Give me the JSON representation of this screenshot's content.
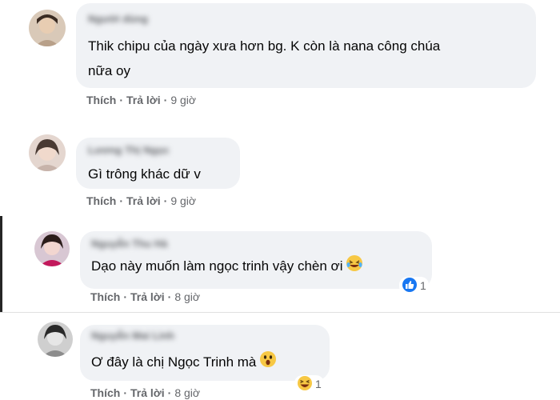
{
  "comments": [
    {
      "author": "Người dùng",
      "text_line1": "Thik chipu của ngày xưa hơn bg. K còn là nana công chúa",
      "text_line2": "nữa oy",
      "like_label": "Thích",
      "reply_label": "Trả lời",
      "separator": "·",
      "time": "9 giờ"
    },
    {
      "author": "Lương Thị Ngọc",
      "text_line1": "Gì trông khác dữ v",
      "like_label": "Thích",
      "reply_label": "Trả lời",
      "separator": "·",
      "time": "9 giờ"
    },
    {
      "author": "Nguyễn Thu Hà",
      "text_line1": "Dạo này muốn làm ngọc trinh vậy chèn ơi",
      "emoji": "laughing-face-icon",
      "reaction_icon": "like-reaction-icon",
      "reaction_count": "1",
      "like_label": "Thích",
      "reply_label": "Trả lời",
      "separator": "·",
      "time": "8 giờ"
    },
    {
      "author": "Nguyễn Mai Linh",
      "text_line1": "Ơ đây là chị Ngọc Trinh mà",
      "emoji": "surprised-face-icon",
      "reaction_icon": "haha-reaction-icon",
      "reaction_count": "1",
      "like_label": "Thích",
      "reply_label": "Trả lời",
      "separator": "·",
      "time": "8 giờ"
    }
  ],
  "colors": {
    "bubble": "#f0f2f5",
    "text": "#050505",
    "meta": "#65676b",
    "like_blue": "#1877f2",
    "emoji_yellow": "#f7c844"
  }
}
